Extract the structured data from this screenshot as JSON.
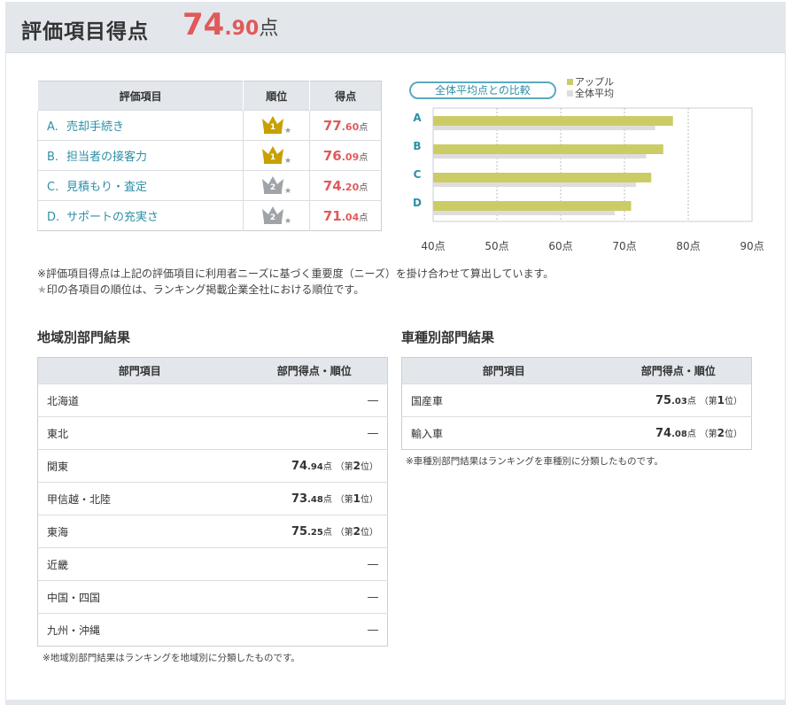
{
  "header": {
    "title": "評価項目得点",
    "total_int": "74",
    "total_dec": ".90",
    "total_unit": "点"
  },
  "eval_table": {
    "headers": [
      "評価項目",
      "順位",
      "得点"
    ],
    "rows": [
      {
        "letter": "A.",
        "label": "売却手続き",
        "rank": "1",
        "rank_icon": "gold-crown-icon",
        "score_int": "77",
        "score_dec": ".60",
        "unit": "点"
      },
      {
        "letter": "B.",
        "label": "担当者の接客力",
        "rank": "1",
        "rank_icon": "gold-crown-icon",
        "score_int": "76",
        "score_dec": ".09",
        "unit": "点"
      },
      {
        "letter": "C.",
        "label": "見積もり・査定",
        "rank": "2",
        "rank_icon": "silver-crown-icon",
        "score_int": "74",
        "score_dec": ".20",
        "unit": "点"
      },
      {
        "letter": "D.",
        "label": "サポートの充実さ",
        "rank": "2",
        "rank_icon": "silver-crown-icon",
        "score_int": "71",
        "score_dec": ".04",
        "unit": "点"
      }
    ]
  },
  "compare_button": "全体平均点との比較",
  "chart_data": {
    "type": "bar",
    "orientation": "horizontal",
    "categories": [
      "A",
      "B",
      "C",
      "D"
    ],
    "series": [
      {
        "name": "アップル",
        "color": "#cccc66",
        "values": [
          77.6,
          76.09,
          74.2,
          71.04
        ]
      },
      {
        "name": "全体平均",
        "color": "#dddddd",
        "values": [
          74.8,
          73.4,
          71.8,
          68.5
        ]
      }
    ],
    "xlim": [
      40,
      90
    ],
    "xticks": [
      "40点",
      "50点",
      "60点",
      "70点",
      "80点",
      "90点"
    ],
    "grid": true,
    "legend": "top-right"
  },
  "notes": {
    "line1": "※評価項目得点は上記の評価項目に利用者ニーズに基づく重要度（ニーズ）を掛け合わせて算出しています。",
    "star": "★",
    "line2": "印の各項目の順位は、ランキング掲載企業全社における順位です。"
  },
  "region": {
    "title": "地域別部門結果",
    "headers": [
      "部門項目",
      "部門得点・順位"
    ],
    "rows": [
      {
        "name": "北海道",
        "empty": "―"
      },
      {
        "name": "東北",
        "empty": "―"
      },
      {
        "name": "関東",
        "int": "74",
        "dec": ".94",
        "unit": "点",
        "rank_pre": "（第",
        "rank": "2",
        "rank_post": "位）"
      },
      {
        "name": "甲信越・北陸",
        "int": "73",
        "dec": ".48",
        "unit": "点",
        "rank_pre": "（第",
        "rank": "1",
        "rank_post": "位）"
      },
      {
        "name": "東海",
        "int": "75",
        "dec": ".25",
        "unit": "点",
        "rank_pre": "（第",
        "rank": "2",
        "rank_post": "位）"
      },
      {
        "name": "近畿",
        "empty": "―"
      },
      {
        "name": "中国・四国",
        "empty": "―"
      },
      {
        "name": "九州・沖縄",
        "empty": "―"
      }
    ],
    "footnote": "※地域別部門結果はランキングを地域別に分類したものです。"
  },
  "vehicle": {
    "title": "車種別部門結果",
    "headers": [
      "部門項目",
      "部門得点・順位"
    ],
    "rows": [
      {
        "name": "国産車",
        "int": "75",
        "dec": ".03",
        "unit": "点",
        "rank_pre": "（第",
        "rank": "1",
        "rank_post": "位）"
      },
      {
        "name": "輸入車",
        "int": "74",
        "dec": ".08",
        "unit": "点",
        "rank_pre": "（第",
        "rank": "2",
        "rank_post": "位）"
      }
    ],
    "footnote": "※車種別部門結果はランキングを車種別に分類したものです。"
  }
}
